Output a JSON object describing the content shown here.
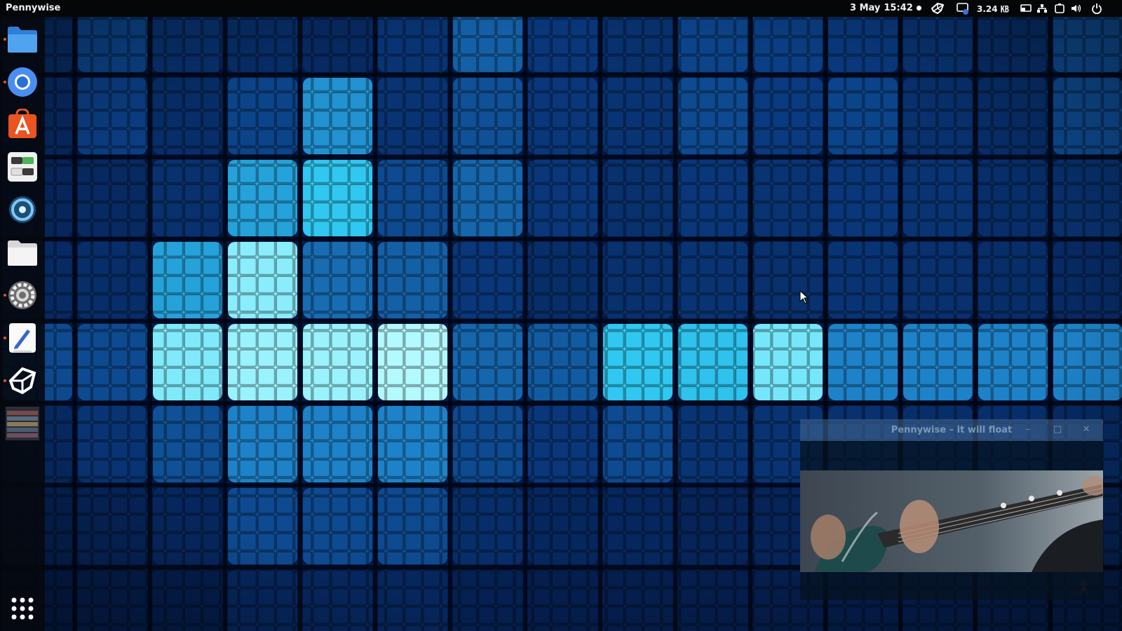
{
  "topbar": {
    "app_menu_label": "Pennywise",
    "date": "3 May",
    "time": "15:42",
    "net_speed": "3.24 ㎅",
    "tray_icons": [
      "unity-icon",
      "chat-notification-icon",
      "screen-icon",
      "network-icon",
      "battery-icon",
      "volume-icon",
      "power-icon"
    ]
  },
  "dock": {
    "items": [
      {
        "name": "files-blue-folder",
        "running": true
      },
      {
        "name": "chromium-browser",
        "running": true
      },
      {
        "name": "software-center",
        "running": false
      },
      {
        "name": "settings-panel-app",
        "running": false
      },
      {
        "name": "blender-like-app",
        "running": false
      },
      {
        "name": "files-manager",
        "running": false
      },
      {
        "name": "system-settings",
        "running": true
      },
      {
        "name": "text-editor",
        "running": true
      },
      {
        "name": "unity-hub",
        "running": true
      },
      {
        "name": "image-thumbnail-app",
        "running": false
      },
      {
        "name": "show-applications",
        "running": false
      }
    ]
  },
  "pip_window": {
    "title": "Pennywise – it will float",
    "minimize": "–",
    "maximize": "□",
    "close": "✕"
  },
  "colors": {
    "accent": "#e95420",
    "wallpaper_dark": "#031540",
    "wallpaper_cyan": "#3fe6ff"
  }
}
